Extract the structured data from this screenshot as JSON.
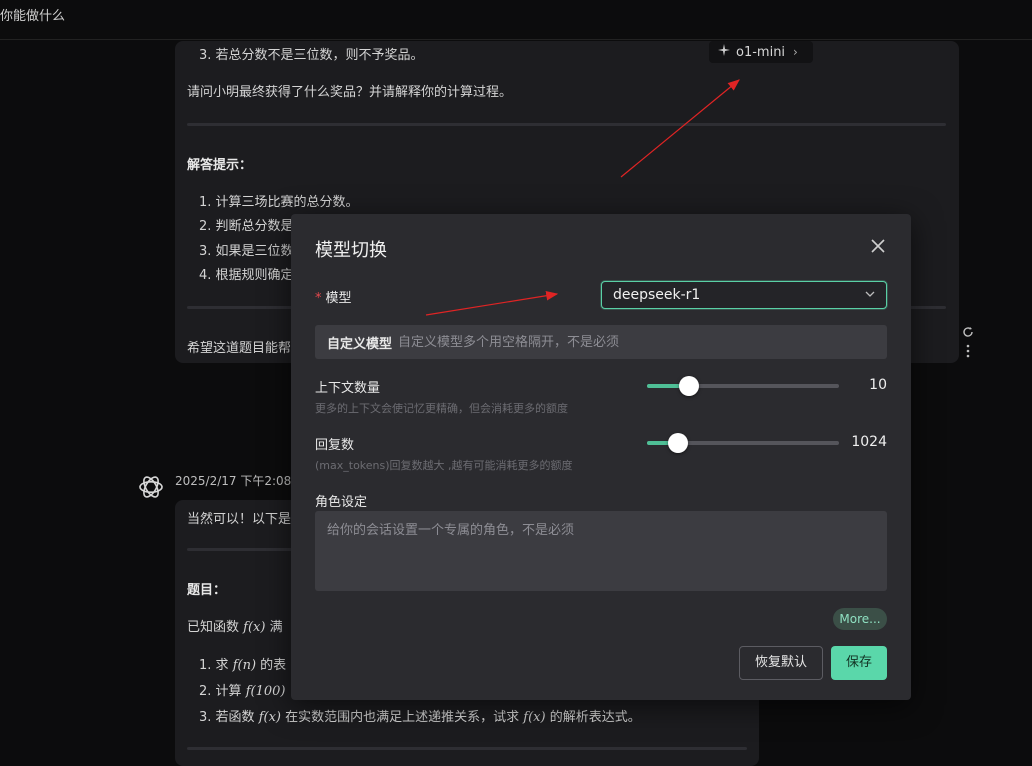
{
  "header": {
    "title": "你能做什么"
  },
  "model_chip": {
    "label": "o1-mini"
  },
  "message1": {
    "rule3": "3. 若总分数不是三位数，则不予奖品。",
    "question": "请问小明最终获得了什么奖品？并请解释你的计算过程。",
    "hint_title": "解答提示：",
    "steps": [
      "1. 计算三场比赛的总分数。",
      "2. 判断总分数是",
      "3. 如果是三位数",
      "4. 根据规则确定"
    ],
    "closing": "希望这道题目能帮"
  },
  "message2": {
    "timestamp": "2025/2/17 下午2:08:3",
    "intro": "当然可以！以下是",
    "title": "题目：",
    "given_prefix": "已知函数",
    "given_fx": "f(x)",
    "given_rest": "满",
    "q1_prefix": "1. 求",
    "q1_fn": "f(n)",
    "q1_rest": "的表",
    "q2_prefix": "2. 计算",
    "q2_fn": "f(100)",
    "q3_prefix": "3. 若函数",
    "q3_fx": "f(x)",
    "q3_mid": "在实数范围内也满足上述递推关系，试求",
    "q3_fx2": "f(x)",
    "q3_end": "的解析表达式。"
  },
  "modal": {
    "title": "模型切换",
    "model_label": "模型",
    "model_value": "deepseek-r1",
    "custom_model_label": "自定义模型",
    "custom_model_placeholder": "自定义模型多个用空格隔开，不是必须",
    "context_label": "上下文数量",
    "context_hint": "更多的上下文会使记忆更精确，但会消耗更多的额度",
    "context_value": "10",
    "context_fraction": 0.22,
    "reply_label": "回复数",
    "reply_hint": "(max_tokens)回复数越大 ,越有可能消耗更多的额度",
    "reply_value": "1024",
    "reply_fraction": 0.16,
    "role_label": "角色设定",
    "role_placeholder": "给你的会话设置一个专属的角色，不是必须",
    "more_label": "More...",
    "reset_label": "恢复默认",
    "save_label": "保存"
  },
  "colors": {
    "accent": "#5ad7aa",
    "annotation_arrow": "#e02424"
  }
}
